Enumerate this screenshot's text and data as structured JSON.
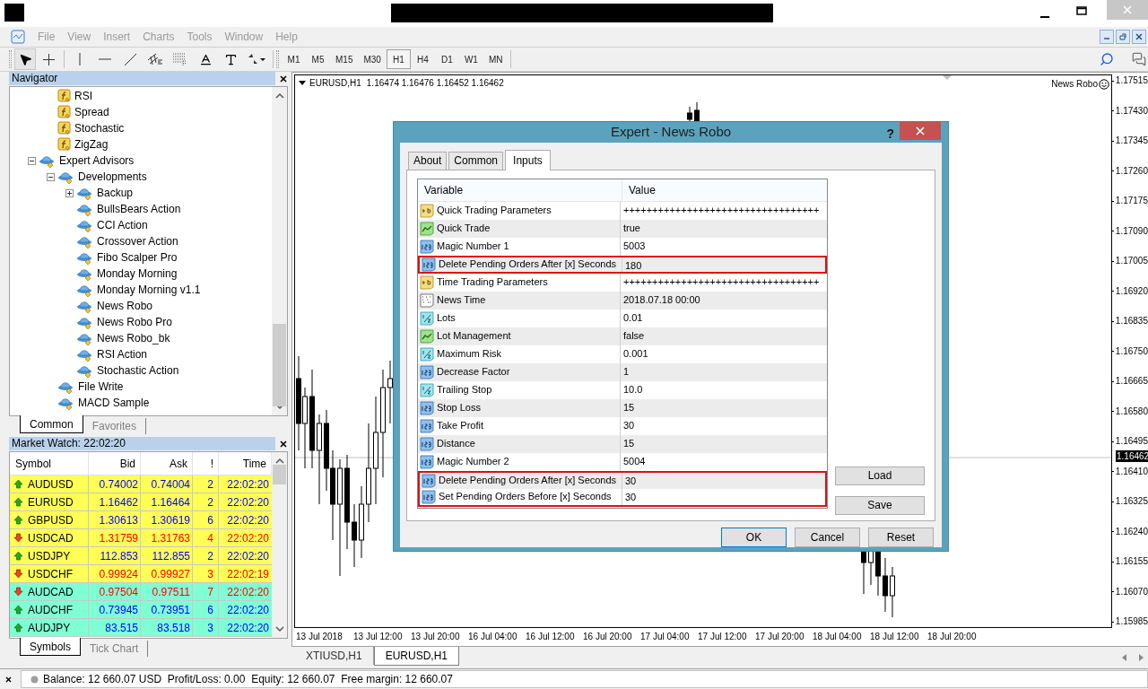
{
  "menu": [
    "File",
    "View",
    "Insert",
    "Charts",
    "Tools",
    "Window",
    "Help"
  ],
  "timeframes": [
    {
      "label": "M1",
      "selected": false
    },
    {
      "label": "M5",
      "selected": false
    },
    {
      "label": "M15",
      "selected": false
    },
    {
      "label": "M30",
      "selected": false
    },
    {
      "label": "H1",
      "selected": true
    },
    {
      "label": "H4",
      "selected": false
    },
    {
      "label": "D1",
      "selected": false
    },
    {
      "label": "W1",
      "selected": false
    },
    {
      "label": "MN",
      "selected": false
    }
  ],
  "navigator": {
    "title": "Navigator",
    "tree": [
      {
        "children": [
          {
            "label": "RSI",
            "kind": "indicator"
          },
          {
            "label": "Spread",
            "kind": "indicator"
          },
          {
            "label": "Stochastic",
            "kind": "indicator"
          },
          {
            "label": "ZigZag",
            "kind": "indicator"
          }
        ]
      },
      {
        "label": "Expert Advisors",
        "kind": "expert",
        "expanded": true,
        "children": [
          {
            "label": "Developments",
            "kind": "expert",
            "expanded": true,
            "children": [
              {
                "label": "Backup",
                "kind": "expert",
                "expanded": false
              },
              {
                "label": "BullsBears Action",
                "kind": "expert"
              },
              {
                "label": "CCI Action",
                "kind": "expert"
              },
              {
                "label": "Crossover Action",
                "kind": "expert"
              },
              {
                "label": "Fibo Scalper Pro",
                "kind": "expert"
              },
              {
                "label": "Monday Morning",
                "kind": "expert"
              },
              {
                "label": "Monday Morning v1.1",
                "kind": "expert"
              },
              {
                "label": "News Robo",
                "kind": "expert"
              },
              {
                "label": "News Robo Pro",
                "kind": "expert"
              },
              {
                "label": "News Robo_bk",
                "kind": "expert"
              },
              {
                "label": "RSI Action",
                "kind": "expert"
              },
              {
                "label": "Stochastic Action",
                "kind": "expert"
              }
            ]
          },
          {
            "label": "File Write",
            "kind": "expert"
          },
          {
            "label": "MACD Sample",
            "kind": "expert"
          }
        ]
      }
    ],
    "tabs": [
      {
        "label": "Common",
        "selected": true
      },
      {
        "label": "Favorites",
        "selected": false
      }
    ]
  },
  "market_watch": {
    "title": "Market Watch: 22:02:20",
    "columns": [
      "Symbol",
      "Bid",
      "Ask",
      "!",
      "Time"
    ],
    "rows": [
      {
        "symbol": "AUDUSD",
        "bid": "0.74002",
        "ask": "0.74004",
        "spread": "2",
        "time": "22:02:20",
        "kind": "up",
        "color": "#ffff55"
      },
      {
        "symbol": "EURUSD",
        "bid": "1.16462",
        "ask": "1.16464",
        "spread": "2",
        "time": "22:02:20",
        "kind": "up",
        "color": "#ffff55"
      },
      {
        "symbol": "GBPUSD",
        "bid": "1.30613",
        "ask": "1.30619",
        "spread": "6",
        "time": "22:02:20",
        "kind": "up",
        "color": "#ffff55"
      },
      {
        "symbol": "USDCAD",
        "bid": "1.31759",
        "ask": "1.31763",
        "spread": "4",
        "time": "22:02:20",
        "kind": "down",
        "color": "#ffff55"
      },
      {
        "symbol": "USDJPY",
        "bid": "112.853",
        "ask": "112.855",
        "spread": "2",
        "time": "22:02:20",
        "kind": "up",
        "color": "#ffff55"
      },
      {
        "symbol": "USDCHF",
        "bid": "0.99924",
        "ask": "0.99927",
        "spread": "3",
        "time": "22:02:19",
        "kind": "down",
        "color": "#ffff55"
      },
      {
        "symbol": "AUDCAD",
        "bid": "0.97504",
        "ask": "0.97511",
        "spread": "7",
        "time": "22:02:20",
        "kind": "down",
        "color": "#7fffd4"
      },
      {
        "symbol": "AUDCHF",
        "bid": "0.73945",
        "ask": "0.73951",
        "spread": "6",
        "time": "22:02:20",
        "kind": "up",
        "color": "#7fffd4"
      },
      {
        "symbol": "AUDJPY",
        "bid": "83.515",
        "ask": "83.518",
        "spread": "3",
        "time": "22:02:20",
        "kind": "up",
        "color": "#7fffd4"
      }
    ],
    "tabs": [
      {
        "label": "Symbols",
        "selected": true
      },
      {
        "label": "Tick Chart",
        "selected": false
      }
    ]
  },
  "chart": {
    "symbol": "EURUSD,H1",
    "ohlc": "1.16474 1.16476 1.16452 1.16462",
    "expert": "News Robo",
    "price_labels": [
      "1.17515",
      "1.17430",
      "1.17345",
      "1.17260",
      "1.17175",
      "1.17090",
      "1.17005",
      "1.16920",
      "1.16835",
      "1.16750",
      "1.16665",
      "1.16580",
      "1.16495",
      "1.16410",
      "1.16325",
      "1.16240",
      "1.16155",
      "1.16070",
      "1.15985"
    ],
    "current_price": "1.16462",
    "time_labels": [
      "13 Jul 2018",
      "13 Jul 12:00",
      "13 Jul 20:00",
      "16 Jul 04:00",
      "16 Jul 12:00",
      "16 Jul 20:00",
      "17 Jul 04:00",
      "17 Jul 12:00",
      "17 Jul 20:00",
      "18 Jul 04:00",
      "18 Jul 12:00",
      "18 Jul 20:00"
    ],
    "tabs": [
      {
        "label": "XTIUSD,H1",
        "selected": false
      },
      {
        "label": "EURUSD,H1",
        "selected": true
      }
    ]
  },
  "dialog": {
    "title": "Expert - News Robo",
    "help": "?",
    "tabs": [
      {
        "label": "About",
        "selected": false
      },
      {
        "label": "Common",
        "selected": false
      },
      {
        "label": "Inputs",
        "selected": true
      }
    ],
    "columns": [
      "Variable",
      "Value"
    ],
    "rows": [
      {
        "kind": "string",
        "name": "Quick Trading Parameters",
        "value": "++++++++++++++++++++++++++++++++++",
        "highlighted": false
      },
      {
        "kind": "bool",
        "name": "Quick Trade",
        "value": "true",
        "highlighted": false
      },
      {
        "kind": "int",
        "name": "Magic Number 1",
        "value": "5003",
        "highlighted": false
      },
      {
        "kind": "int",
        "name": "Delete Pending Orders After [x] Seconds",
        "value": "180",
        "highlighted": true
      },
      {
        "kind": "string",
        "name": "Time Trading Parameters",
        "value": "++++++++++++++++++++++++++++++++++",
        "highlighted": false
      },
      {
        "kind": "datetime",
        "name": "News Time",
        "value": "2018.07.18 00:00",
        "highlighted": false
      },
      {
        "kind": "double",
        "name": "Lots",
        "value": "0.01",
        "highlighted": false
      },
      {
        "kind": "bool",
        "name": "Lot Management",
        "value": "false",
        "highlighted": false
      },
      {
        "kind": "double",
        "name": "Maximum Risk",
        "value": "0.001",
        "highlighted": false
      },
      {
        "kind": "int",
        "name": "Decrease Factor",
        "value": "1",
        "highlighted": false
      },
      {
        "kind": "double",
        "name": "Trailing Stop",
        "value": "10.0",
        "highlighted": false
      },
      {
        "kind": "int",
        "name": "Stop Loss",
        "value": "15",
        "highlighted": false
      },
      {
        "kind": "int",
        "name": "Take Profit",
        "value": "30",
        "highlighted": false
      },
      {
        "kind": "int",
        "name": "Distance",
        "value": "15",
        "highlighted": false
      },
      {
        "kind": "int",
        "name": "Magic Number 2",
        "value": "5004",
        "highlighted": false
      },
      {
        "kind": "int",
        "name": "Delete Pending Orders After [x] Seconds",
        "value": "30",
        "highlighted": true
      },
      {
        "kind": "int",
        "name": "Set Pending Orders Before [x] Seconds",
        "value": "30",
        "highlighted": true
      }
    ],
    "side_buttons": [
      "Load",
      "Save"
    ],
    "buttons": [
      "OK",
      "Cancel",
      "Reset"
    ]
  },
  "status_bar": {
    "text": "Balance: 12 660.07 USD  Profit/Loss: 0.00  Equity: 12 660.07  Free margin: 12 660.07"
  }
}
